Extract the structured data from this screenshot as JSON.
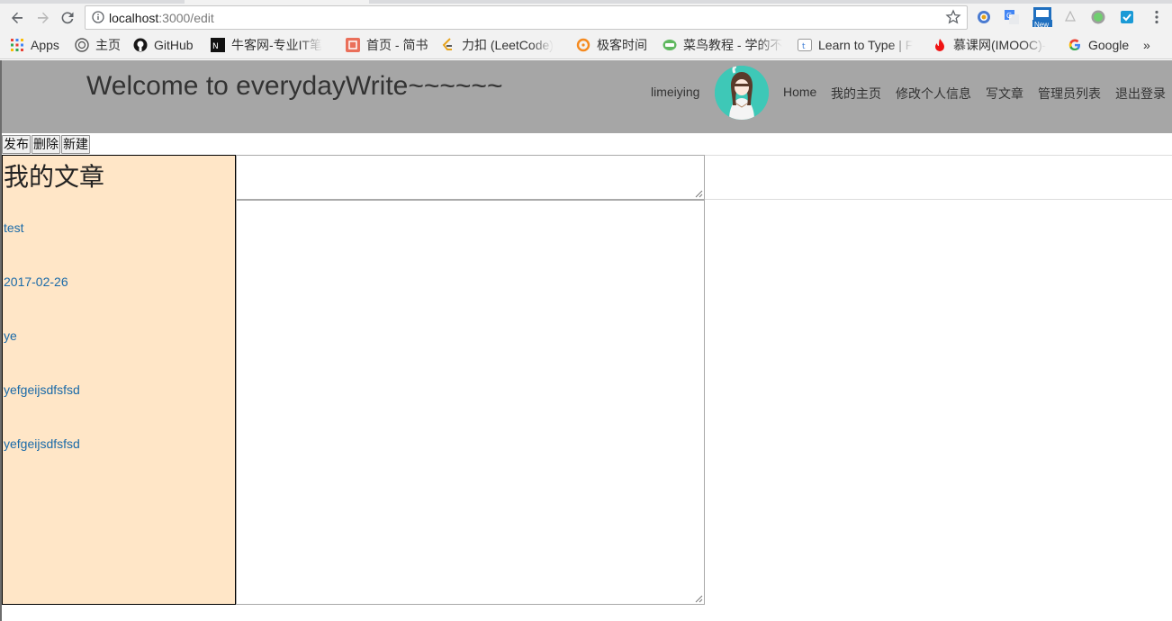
{
  "browser": {
    "url_host": "localhost",
    "url_path": ":3000/edit",
    "bookmarks": [
      {
        "label": "Apps",
        "icon": "apps-grid-icon"
      },
      {
        "label": "主页",
        "icon": "home-icon"
      },
      {
        "label": "GitHub",
        "icon": "github-icon"
      },
      {
        "label": "牛客网-专业IT笔",
        "icon": "nowcoder-icon"
      },
      {
        "label": "首页 - 简书",
        "icon": "jianshu-icon"
      },
      {
        "label": "力扣 (LeetCode)",
        "icon": "leetcode-icon"
      },
      {
        "label": "极客时间",
        "icon": "geektime-icon"
      },
      {
        "label": "菜鸟教程 - 学的不",
        "icon": "runoob-icon"
      },
      {
        "label": "Learn to Type | F",
        "icon": "typing-icon"
      },
      {
        "label": "慕课网(IMOOC)-",
        "icon": "imooc-icon"
      },
      {
        "label": "Google",
        "icon": "google-icon"
      }
    ],
    "more_label": "»",
    "new_badge": "New"
  },
  "header": {
    "title": "Welcome to everydayWrite~~~~~~",
    "username": "limeiying",
    "nav": [
      "Home",
      "我的主页",
      "修改个人信息",
      "写文章",
      "管理员列表",
      "退出登录"
    ]
  },
  "actions": {
    "publish": "发布",
    "delete": "删除",
    "new": "新建"
  },
  "sidebar": {
    "title": "我的文章",
    "articles": [
      "test",
      "2017-02-26",
      "ye",
      "yefgeijsdfsfsd",
      "yefgeijsdfsfsd"
    ]
  },
  "colors": {
    "header_bg": "#a6a6a6",
    "sidebar_bg": "#ffe6c7",
    "link": "#1a6aa8"
  }
}
